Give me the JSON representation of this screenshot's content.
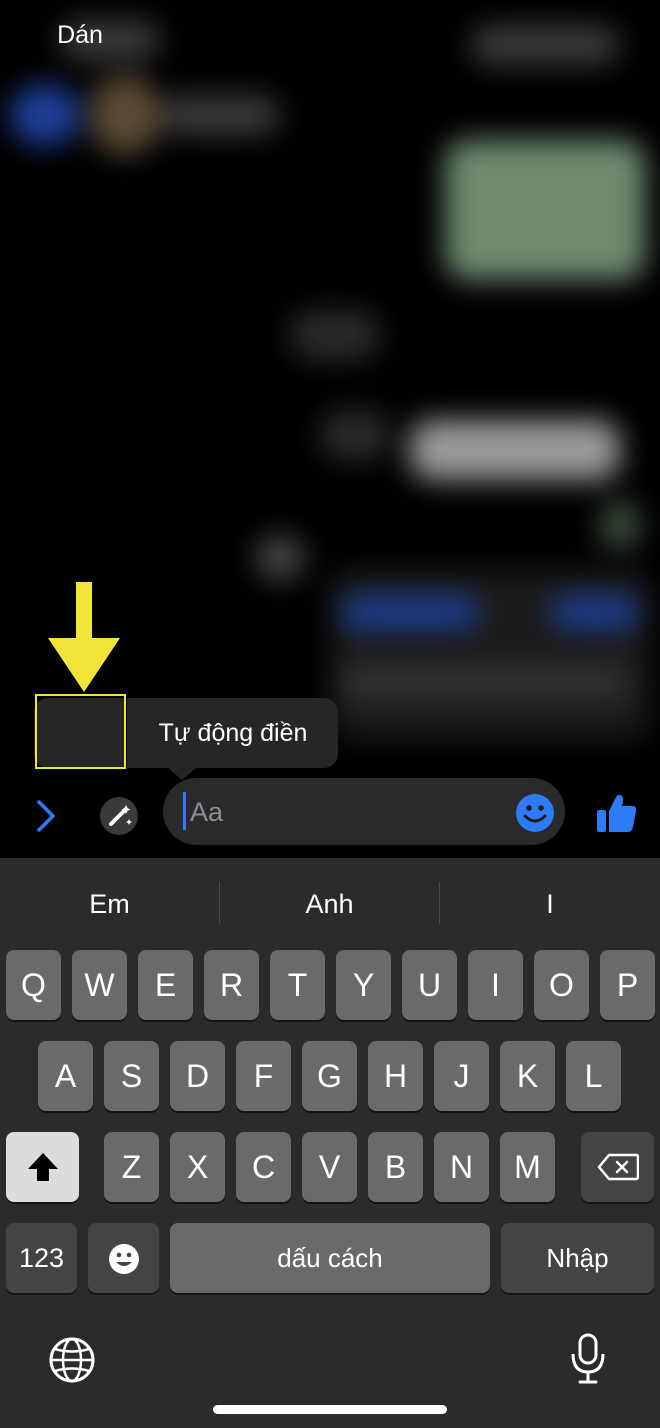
{
  "context_menu": {
    "paste": "Dán",
    "autofill": "Tự động điền"
  },
  "composer": {
    "placeholder": "Aa"
  },
  "suggestions": [
    "Em",
    "Anh",
    "I"
  ],
  "keyboard": {
    "row1": [
      "Q",
      "W",
      "E",
      "R",
      "T",
      "Y",
      "U",
      "I",
      "O",
      "P"
    ],
    "row2": [
      "A",
      "S",
      "D",
      "F",
      "G",
      "H",
      "J",
      "K",
      "L"
    ],
    "row3": [
      "Z",
      "X",
      "C",
      "V",
      "B",
      "N",
      "M"
    ],
    "numbers_key": "123",
    "space_label": "dấu cách",
    "return_label": "Nhập"
  },
  "colors": {
    "accent": "#2d7cf6",
    "annotation": "#f1e53a"
  }
}
